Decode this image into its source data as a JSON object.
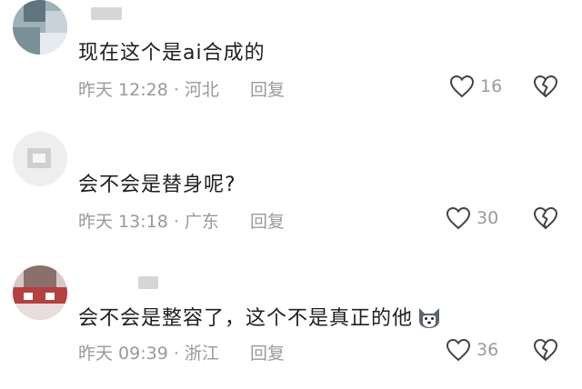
{
  "comments": [
    {
      "text": "现在这个是ai合成的",
      "time": "昨天 12:28 · 河北",
      "reply_label": "回复",
      "likes": "16"
    },
    {
      "text": "会不会是替身呢?",
      "time": "昨天 13:18 · 广东",
      "reply_label": "回复",
      "likes": "30"
    },
    {
      "text": "会不会是整容了，这个不是真正的他",
      "time": "昨天 09:39 · 浙江",
      "reply_label": "回复",
      "likes": "36"
    }
  ],
  "icons": {
    "like": "heart-outline-icon",
    "dislike": "broken-heart-icon",
    "emoji": "husky-dog-emoji-icon"
  },
  "colors": {
    "text": "#1f1f1f",
    "meta": "#999999",
    "icon": "#444444"
  }
}
